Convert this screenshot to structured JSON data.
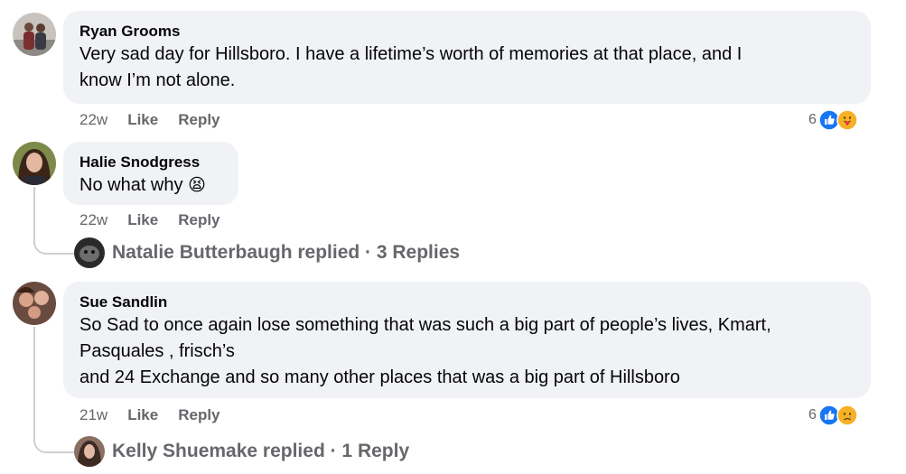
{
  "comments": [
    {
      "author": "Ryan Grooms",
      "text": "Very sad day for Hillsboro. I have a lifetime’s worth of memories at that place, and I\nknow I’m not alone.",
      "time": "22w",
      "like_label": "Like",
      "reply_label": "Reply",
      "reaction_count": "6",
      "reactions": [
        "like-icon",
        "care-icon"
      ]
    },
    {
      "author": "Halie Snodgress",
      "text": "No what why",
      "emoji": "😫",
      "time": "22w",
      "like_label": "Like",
      "reply_label": "Reply",
      "replies_summary": "Natalie Butterbaugh replied · 3 Replies"
    },
    {
      "author": "Sue Sandlin",
      "text": "So Sad to once again lose something that was such a big part of people’s lives, Kmart,\nPasquales , frisch’s\nand 24 Exchange and so many other places that was a big part of Hillsboro",
      "time": "21w",
      "like_label": "Like",
      "reply_label": "Reply",
      "reaction_count": "6",
      "reactions": [
        "like-icon",
        "sad-icon"
      ],
      "replies_summary": "Kelly Shuemake replied · 1 Reply"
    }
  ],
  "colors": {
    "bubble": "#f0f2f5",
    "meta_text": "#65676b",
    "like_blue": "#1877f2",
    "thread_line": "#ced0d4"
  }
}
